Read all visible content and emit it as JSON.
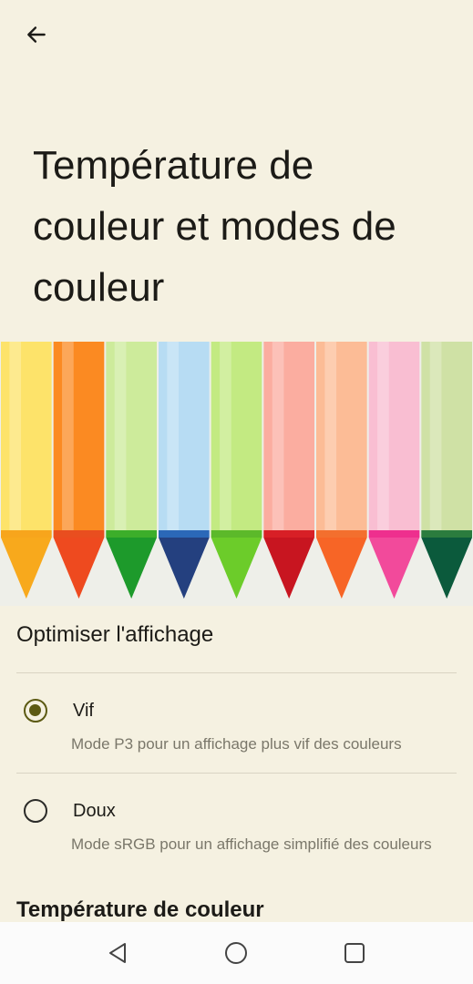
{
  "header": {
    "back_icon": "arrow-left-icon",
    "title": "Température de couleur et modes de couleur"
  },
  "hero": {
    "description": "crayons illustration",
    "crayon_colors": [
      {
        "body": "#fde36a",
        "band": "#f7a51c",
        "tip": "#f8a91c"
      },
      {
        "body": "#fb8a22",
        "band": "#e94e1f",
        "tip": "#ee4a1f"
      },
      {
        "body": "#cdeb9b",
        "band": "#3cae2a",
        "tip": "#1d9a2b"
      },
      {
        "body": "#b7dcf3",
        "band": "#2b68b8",
        "tip": "#24407f"
      },
      {
        "body": "#c3ea82",
        "band": "#5cb92a",
        "tip": "#6ccc2a"
      },
      {
        "body": "#fbada0",
        "band": "#d81f26",
        "tip": "#c81520"
      },
      {
        "body": "#fcbc96",
        "band": "#f36f2e",
        "tip": "#f76526"
      },
      {
        "body": "#f9bed2",
        "band": "#ee2f8e",
        "tip": "#f24a9b"
      },
      {
        "body": "#cfe1a5",
        "band": "#2b7c3e",
        "tip": "#0b5a3c"
      }
    ]
  },
  "display": {
    "section_title": "Optimiser l'affichage",
    "options": [
      {
        "label": "Vif",
        "description": "Mode P3 pour un affichage plus vif des couleurs",
        "selected": true
      },
      {
        "label": "Doux",
        "description": "Mode sRGB pour un affichage simplifié des couleurs",
        "selected": false
      }
    ]
  },
  "color_temperature": {
    "section_title": "Température de couleur"
  },
  "nav": {
    "back_icon": "triangle-back-icon",
    "home_icon": "circle-home-icon",
    "recents_icon": "square-recents-icon"
  },
  "colors": {
    "background": "#f5f1e1",
    "accent": "#5c5a13",
    "secondary_text": "#7a776a"
  }
}
